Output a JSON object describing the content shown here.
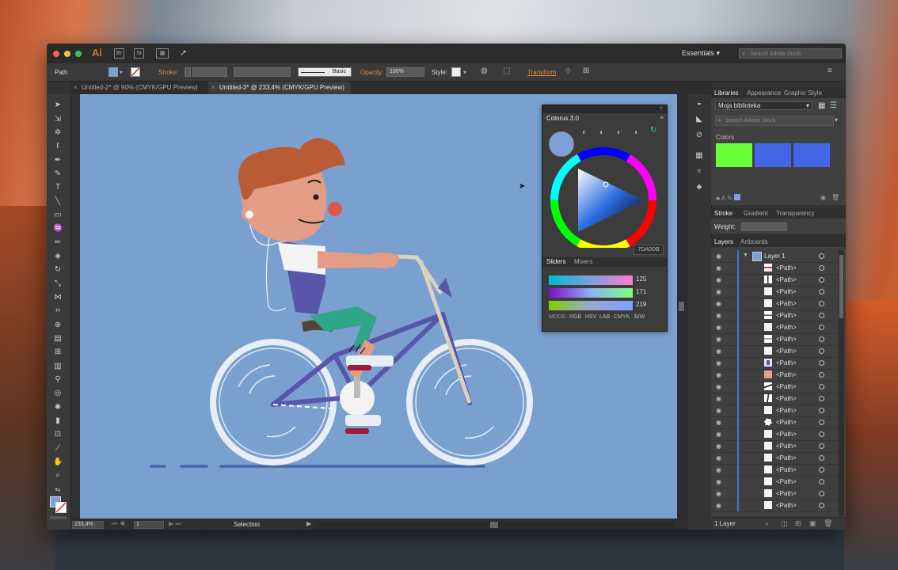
{
  "window": {
    "app_logo": "Ai",
    "bridge_label": "Br",
    "stock_label": "St",
    "workspace": "Essentials",
    "search_placeholder": "Search Adobe Stock"
  },
  "control_bar": {
    "selection_label": "Path",
    "stroke_label": "Stroke:",
    "brush_label": "Basic",
    "opacity_label": "Opacity:",
    "opacity_value": "100%",
    "style_label": "Style:",
    "transform_label": "Transform"
  },
  "tabs": [
    {
      "label": "Untitled-2* @ 90% (CMYK/GPU Preview)",
      "active": false
    },
    {
      "label": "Untitled-3* @ 233,4% (CMYK/GPU Preview)",
      "active": true
    }
  ],
  "status": {
    "zoom": "233,4%",
    "artboard": "1",
    "tool": "Selection"
  },
  "colorus": {
    "title": "Colorus 3.0",
    "hex": "7DA0DB",
    "tabs": [
      "Sliders",
      "Mixers"
    ],
    "sliders": [
      {
        "value": "125"
      },
      {
        "value": "171"
      },
      {
        "value": "219"
      }
    ],
    "modes_label": "MODE:",
    "modes": [
      "RGB",
      "HSV",
      "LAB",
      "CMYK",
      "B/W"
    ],
    "current_color": "#7DA0DB"
  },
  "libraries": {
    "tabs": [
      "Libraries",
      "Appearance",
      "Graphic Style"
    ],
    "library_name": "Moja biblioteka",
    "search_placeholder": "Search Adobe Stock",
    "colors_label": "Colors",
    "swatches": [
      "#6aff3a",
      "#4466e6",
      "#4466e6"
    ]
  },
  "stroke_panel": {
    "tabs": [
      "Stroke",
      "Gradient",
      "Transparency"
    ],
    "weight_label": "Weight:"
  },
  "layers_panel": {
    "tabs": [
      "Layers",
      "Artboards"
    ],
    "layer_name": "Layer 1",
    "path_label": "<Path>",
    "footer": "1 Layer",
    "accent": "#4a6ee0"
  }
}
